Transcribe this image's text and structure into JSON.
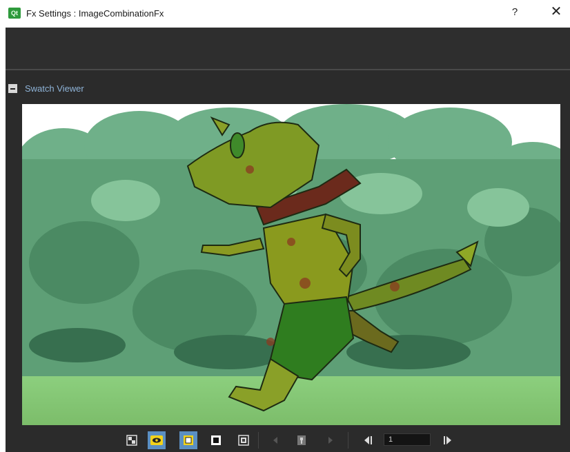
{
  "window": {
    "app_icon_text": "Qt",
    "title": "Fx Settings : ImageCombinationFx",
    "help_label": "?",
    "close_label": "✕"
  },
  "swatch_viewer": {
    "collapse_label": "−",
    "title": "Swatch Viewer"
  },
  "toolbar": {
    "buttons": [
      {
        "icon": "checkerboard-background-icon",
        "active": false
      },
      {
        "icon": "eye-preview-icon",
        "active": true
      },
      {
        "icon": "white-background-icon",
        "active": true
      },
      {
        "icon": "black-background-icon",
        "active": false
      },
      {
        "icon": "checkered-background-icon",
        "active": false
      },
      {
        "icon": "prev-arrow-icon",
        "active": false
      },
      {
        "icon": "key-frame-icon",
        "active": false
      },
      {
        "icon": "next-arrow-icon",
        "active": false
      },
      {
        "icon": "first-frame-icon",
        "active": false
      },
      {
        "icon": "last-frame-icon",
        "active": false
      }
    ],
    "frame_value": "1"
  },
  "colors": {
    "accent": "#5b8fc2",
    "dark_bg": "#2b2b2b",
    "header_text": "#8fb4d8"
  }
}
